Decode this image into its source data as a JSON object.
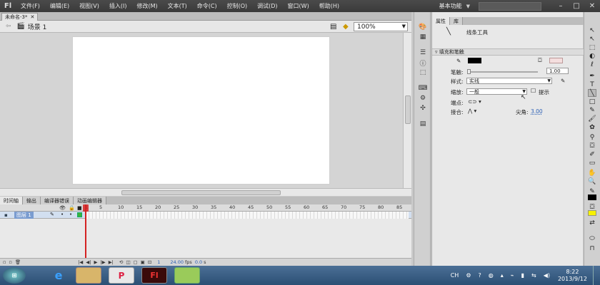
{
  "app": {
    "logo": "Fl"
  },
  "menu": [
    "文件(F)",
    "编辑(E)",
    "视图(V)",
    "插入(I)",
    "修改(M)",
    "文本(T)",
    "命令(C)",
    "控制(O)",
    "调试(D)",
    "窗口(W)",
    "帮助(H)"
  ],
  "workspace": "基本功能",
  "document_tab": "未命名-3*",
  "scene": {
    "label": "场景 1",
    "zoom": "100%"
  },
  "timeline": {
    "tabs": [
      "时间轴",
      "输出",
      "编译器错误",
      "动画编辑器"
    ],
    "ruler": [
      "1",
      "5",
      "10",
      "15",
      "20",
      "25",
      "30",
      "35",
      "40",
      "45",
      "50",
      "55",
      "60",
      "65",
      "70",
      "75",
      "80",
      "85"
    ],
    "layer_name": "图层 1",
    "footer": {
      "frame": "1",
      "fps": "24.00",
      "fps_unit": "fps",
      "time": "0.0",
      "time_unit": "s"
    }
  },
  "properties": {
    "tabs": [
      "属性",
      "库"
    ],
    "tool_name": "线条工具",
    "section_fill_stroke": "填充和笔触",
    "stroke_label": "笔触:",
    "stroke_value": "1.00",
    "style_label": "样式:",
    "style_value": "实线",
    "scale_label": "缩放:",
    "scale_value": "一般",
    "hint_label": "提示",
    "cap_label": "端点:",
    "join_label": "接合:",
    "miter_label": "尖角:",
    "miter_value": "3.00",
    "stroke_color": "#000000",
    "fill_color": "#f4dede"
  },
  "tools": {
    "stroke_color": "#000000",
    "fill_color": "#f7f200"
  },
  "taskbar": {
    "apps": [
      "start-orb",
      "ie",
      "explorer",
      "powerpoint",
      "flash",
      "folder-green"
    ],
    "lang": "CH",
    "time": "8:22",
    "date": "2013/9/12"
  }
}
